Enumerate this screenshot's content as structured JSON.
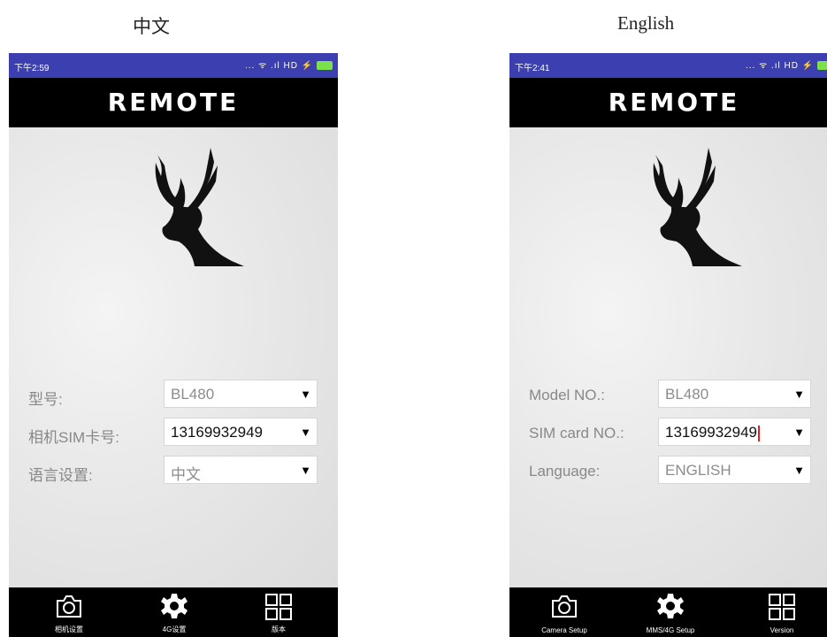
{
  "left": {
    "caption": "中文",
    "status_time": "下午2:59",
    "status_icons": "... ᯤ .ıl HD ⚡",
    "app_title": "REMOTE",
    "form": [
      {
        "label": "型号:",
        "value": "BL480",
        "value_dark": false
      },
      {
        "label": "相机SIM卡号:",
        "value": "13169932949",
        "value_dark": true
      },
      {
        "label": "语言设置:",
        "value": "中文",
        "value_dark": false
      }
    ],
    "tabs": [
      {
        "label": "相机设置",
        "icon": "camera-icon"
      },
      {
        "label": "4G设置",
        "icon": "gear-icon"
      },
      {
        "label": "版本",
        "icon": "grid-icon"
      }
    ]
  },
  "right": {
    "caption": "English",
    "status_time": "下午2:41",
    "status_icons": "... ᯤ .ıl HD ⚡",
    "app_title": "REMOTE",
    "form": [
      {
        "label": "Model NO.:",
        "value": "BL480",
        "value_dark": false
      },
      {
        "label": "SIM card NO.:",
        "value": "13169932949",
        "value_dark": true
      },
      {
        "label": "Language:",
        "value": "ENGLISH",
        "value_dark": false
      }
    ],
    "tabs": [
      {
        "label": "Camera Setup",
        "icon": "camera-icon"
      },
      {
        "label": "MMS/4G Setup",
        "icon": "gear-icon"
      },
      {
        "label": "Version",
        "icon": "grid-icon"
      }
    ]
  },
  "colors": {
    "status_bar": "#3b3fb0",
    "bars": "#000000",
    "battery": "#7ce04a"
  }
}
